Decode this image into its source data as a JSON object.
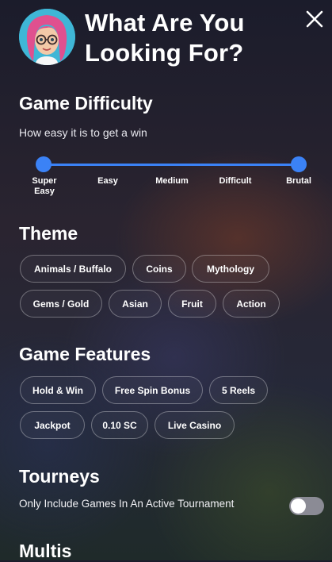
{
  "header": {
    "title": "What Are You Looking For?",
    "close_icon": "close-icon",
    "avatar_icon": "avatar"
  },
  "difficulty": {
    "title": "Game Difficulty",
    "subtitle": "How easy it is to get a win",
    "levels": [
      "Super Easy",
      "Easy",
      "Medium",
      "Difficult",
      "Brutal"
    ],
    "selected_min": "Super Easy",
    "selected_max": "Brutal",
    "accent": "#3b82f6"
  },
  "theme": {
    "title": "Theme",
    "chips": [
      "Animals / Buffalo",
      "Coins",
      "Mythology",
      "Gems / Gold",
      "Asian",
      "Fruit",
      "Action"
    ]
  },
  "features": {
    "title": "Game Features",
    "chips": [
      "Hold & Win",
      "Free Spin Bonus",
      "5 Reels",
      "Jackpot",
      "0.10 SC",
      "Live Casino"
    ]
  },
  "tourneys": {
    "title": "Tourneys",
    "toggle_label": "Only Include Games In An Active Tournament",
    "toggle_on": false
  },
  "multis": {
    "title": "Multis"
  }
}
